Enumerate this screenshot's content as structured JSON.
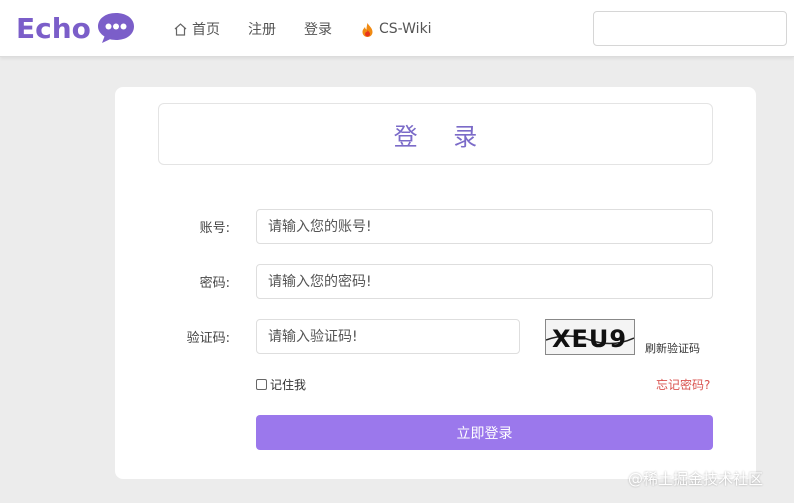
{
  "brand": {
    "name": "Echo",
    "accent": "#7b5ec9"
  },
  "nav": {
    "items": [
      {
        "label": "首页",
        "icon": "home-icon"
      },
      {
        "label": "注册"
      },
      {
        "label": "登录"
      },
      {
        "label": "CS-Wiki",
        "icon": "flame-icon"
      }
    ],
    "search_placeholder": ""
  },
  "login": {
    "title": "登 录",
    "fields": {
      "account": {
        "label": "账号:",
        "placeholder": "请输入您的账号!"
      },
      "password": {
        "label": "密码:",
        "placeholder": "请输入您的密码!"
      },
      "captcha": {
        "label": "验证码:",
        "placeholder": "请输入验证码!",
        "image_text": "XEU9",
        "refresh_label": "刷新验证码"
      }
    },
    "remember_label": "记住我",
    "forgot_label": "忘记密码?",
    "submit_label": "立即登录",
    "submit_color": "#9b78ec"
  },
  "watermark": "@稀土掘金技术社区"
}
